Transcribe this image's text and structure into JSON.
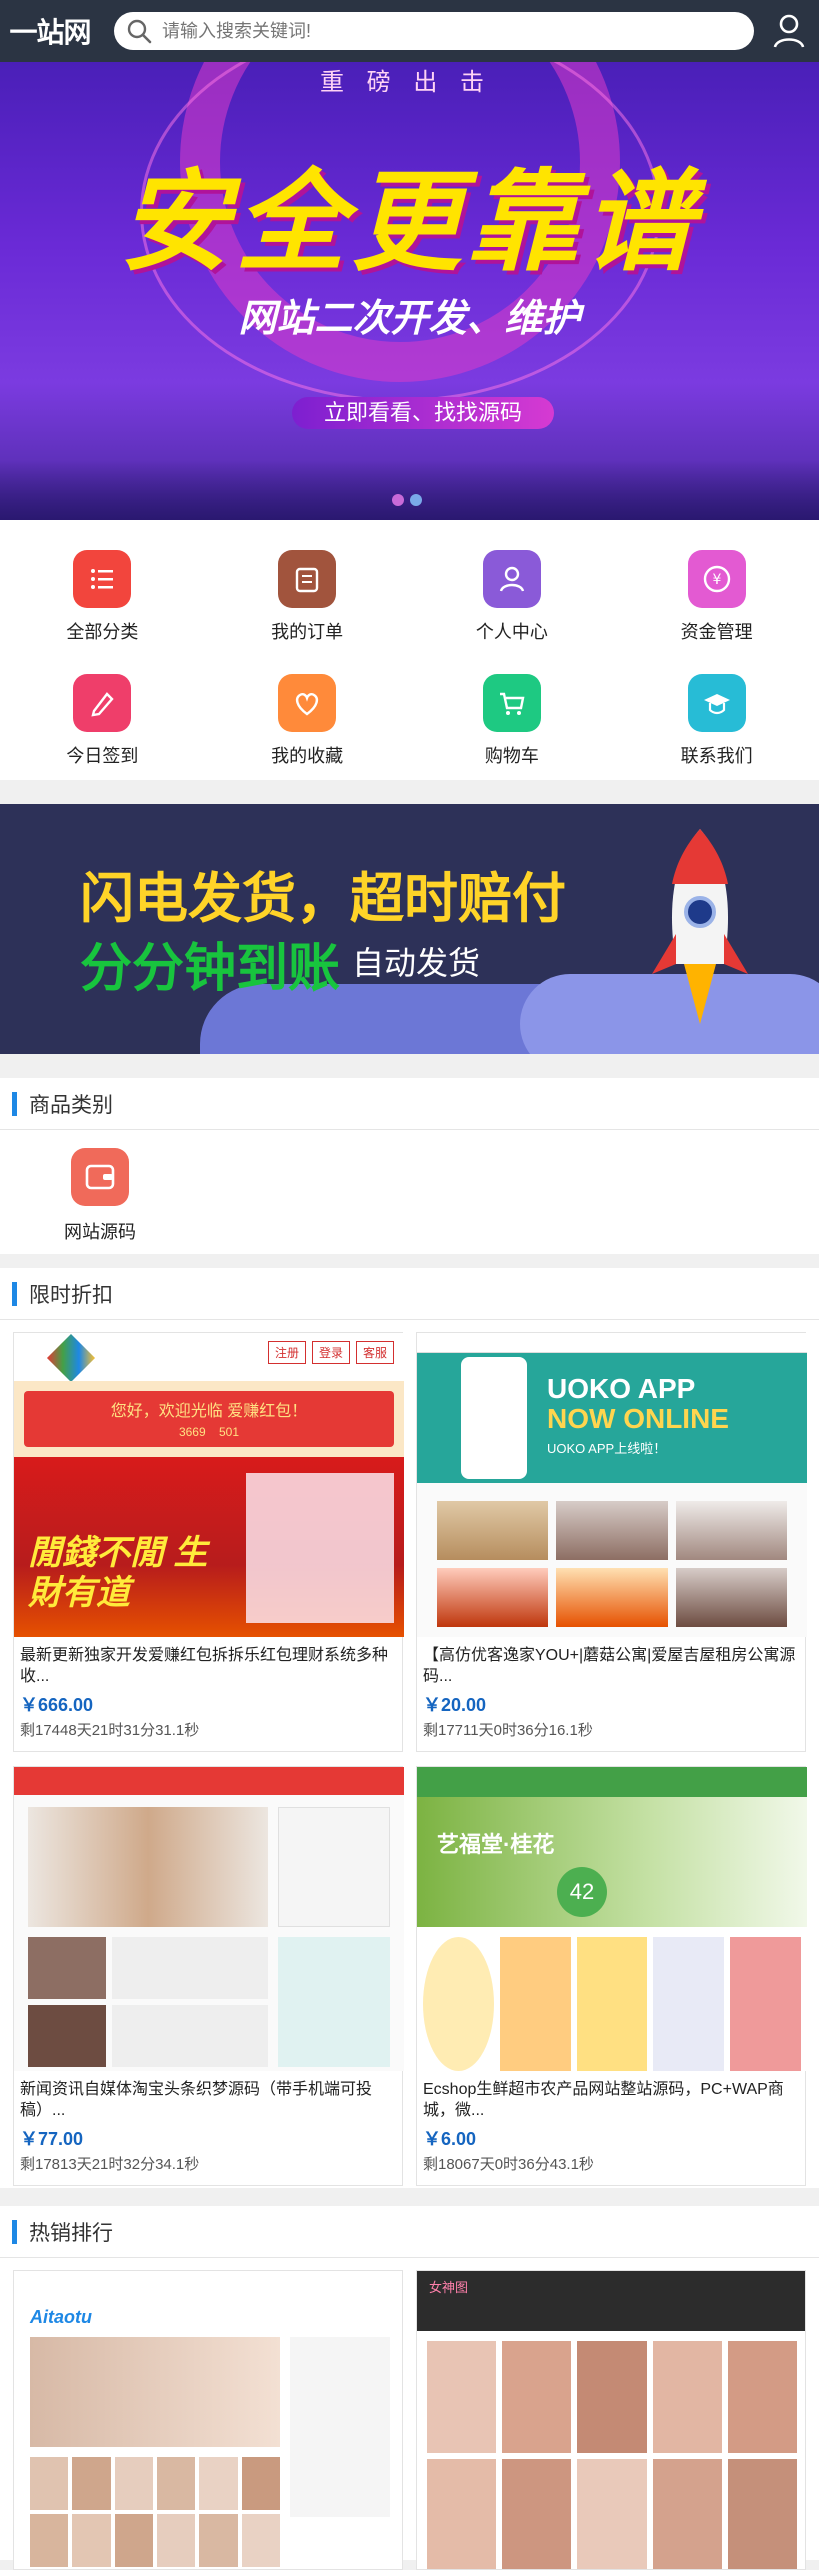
{
  "header": {
    "logo": "一站网",
    "search_placeholder": "请输入搜索关键词!"
  },
  "banner": {
    "headline": "安全更靠谱",
    "subline": "网站二次开发、维护",
    "cta": "立即看看、找找源码",
    "arc_text": "重 磅 出 击"
  },
  "menu": {
    "items": [
      {
        "label": "全部分类",
        "color": "#f2453d"
      },
      {
        "label": "我的订单",
        "color": "#a1543d"
      },
      {
        "label": "个人中心",
        "color": "#8a5ad8"
      },
      {
        "label": "资金管理",
        "color": "#e35ad2"
      },
      {
        "label": "今日签到",
        "color": "#ef3e6a"
      },
      {
        "label": "我的收藏",
        "color": "#ff8a3a"
      },
      {
        "label": "购物车",
        "color": "#1ec982"
      },
      {
        "label": "联系我们",
        "color": "#27bcd6"
      }
    ]
  },
  "promo": {
    "line1": "闪电发货，超时赔付",
    "line2": "分分钟到账",
    "line3": "自动发货"
  },
  "categories": {
    "title": "商品类别",
    "items": [
      {
        "label": "网站源码",
        "color": "#f06a5a"
      }
    ]
  },
  "flash_sale": {
    "title": "限时折扣",
    "products": [
      {
        "title": "最新更新独家开发爱赚红包拆拆乐红包理财系统多种收...",
        "price": "￥666.00",
        "countdown": "剩17448天21时31分31.1秒",
        "thumb": {
          "top_text": "您好，欢迎光临 爱赚红包！",
          "stats": "3669",
          "stats2": "501",
          "big": "閒錢不閒 生財有道",
          "btns": [
            "注册",
            "登录",
            "客服"
          ]
        }
      },
      {
        "title": "【高仿优客逸家YOU+|蘑菇公寓|爱屋吉屋租房公寓源码...",
        "price": "￥20.00",
        "countdown": "剩17711天0时36分16.1秒",
        "thumb": {
          "top_text": "UOKO APP",
          "sub": "NOW ONLINE",
          "small": "UOKO APP上线啦！"
        }
      },
      {
        "title": "新闻资讯自媒体淘宝头条织梦源码（带手机端可投稿）...",
        "price": "￥77.00",
        "countdown": "剩17813天21时32分34.1秒",
        "thumb": {}
      },
      {
        "title": "Ecshop生鲜超市农产品网站整站源码，PC+WAP商城，微...",
        "price": "￥6.00",
        "countdown": "剩18067天0时36分43.1秒",
        "thumb": {
          "big": "艺福堂·桂花",
          "badge": "42"
        }
      }
    ]
  },
  "hot": {
    "title": "热销排行",
    "items": [
      {
        "logo": "Aitaotu"
      },
      {
        "logo": "女神图"
      }
    ]
  }
}
